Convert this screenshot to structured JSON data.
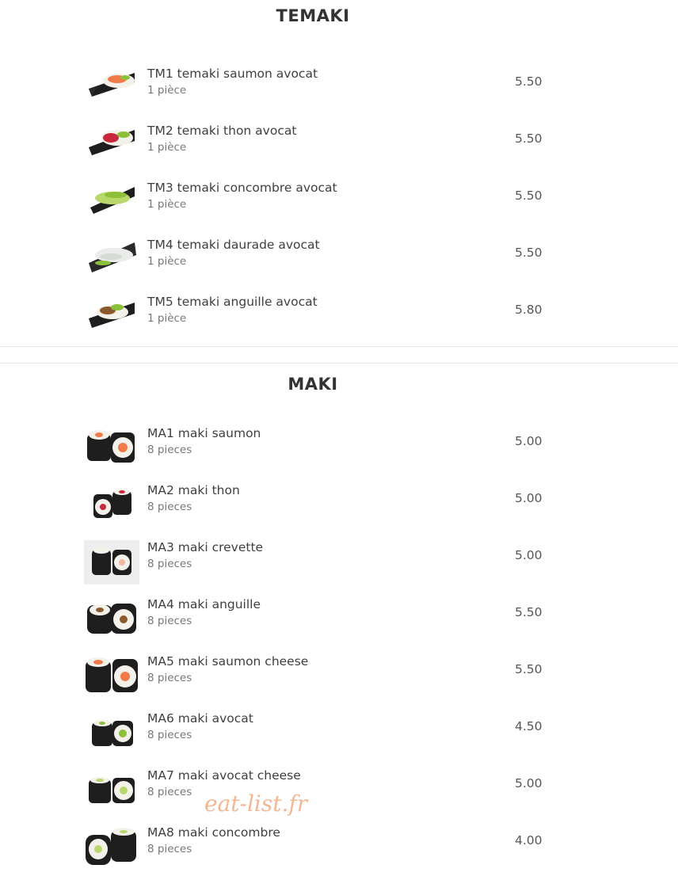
{
  "sections": [
    {
      "title": "TEMAKI",
      "items": [
        {
          "name": "TM1 temaki saumon avocat",
          "qty": "1 pièce",
          "price": "5.50",
          "icon": "temaki-salmon-avocado-image"
        },
        {
          "name": "TM2 temaki thon avocat",
          "qty": "1 pièce",
          "price": "5.50",
          "icon": "temaki-tuna-avocado-image"
        },
        {
          "name": "TM3 temaki concombre avocat",
          "qty": "1 pièce",
          "price": "5.50",
          "icon": "temaki-cucumber-avocado-image"
        },
        {
          "name": "TM4 temaki daurade avocat",
          "qty": "1 pièce",
          "price": "5.50",
          "icon": "temaki-sea-bream-avocado-image"
        },
        {
          "name": "TM5 temaki anguille avocat",
          "qty": "1 pièce",
          "price": "5.80",
          "icon": "temaki-eel-avocado-image"
        }
      ]
    },
    {
      "title": "MAKI",
      "items": [
        {
          "name": "MA1 maki saumon",
          "qty": "8 pieces",
          "price": "5.00",
          "icon": "maki-salmon-image"
        },
        {
          "name": "MA2 maki thon",
          "qty": "8 pieces",
          "price": "5.00",
          "icon": "maki-tuna-image"
        },
        {
          "name": "MA3 maki crevette",
          "qty": "8 pieces",
          "price": "5.00",
          "icon": "maki-shrimp-image"
        },
        {
          "name": "MA4 maki anguille",
          "qty": "8 pieces",
          "price": "5.50",
          "icon": "maki-eel-image"
        },
        {
          "name": "MA5 maki saumon cheese",
          "qty": "8 pieces",
          "price": "5.50",
          "icon": "maki-salmon-cheese-image"
        },
        {
          "name": "MA6 maki avocat",
          "qty": "8 pieces",
          "price": "4.50",
          "icon": "maki-avocado-image"
        },
        {
          "name": "MA7 maki avocat cheese",
          "qty": "8 pieces",
          "price": "5.00",
          "icon": "maki-avocado-cheese-image"
        },
        {
          "name": "MA8 maki concombre",
          "qty": "8 pieces",
          "price": "4.00",
          "icon": "maki-cucumber-image"
        }
      ]
    }
  ],
  "watermark": "eat-list.fr",
  "colors": {
    "text": "#3f3f3f",
    "subtext": "#777777",
    "divider": "#e6e6e6",
    "watermark": "#f2b089",
    "nori": "#1e1e1e",
    "rice": "#f4f1ea",
    "salmon": "#f07a4a",
    "tuna": "#c8283c",
    "avocado": "#8cbf3a",
    "shrimp": "#f3b7a4",
    "eel": "#8a5a2e",
    "cucumber": "#b8d86b"
  }
}
